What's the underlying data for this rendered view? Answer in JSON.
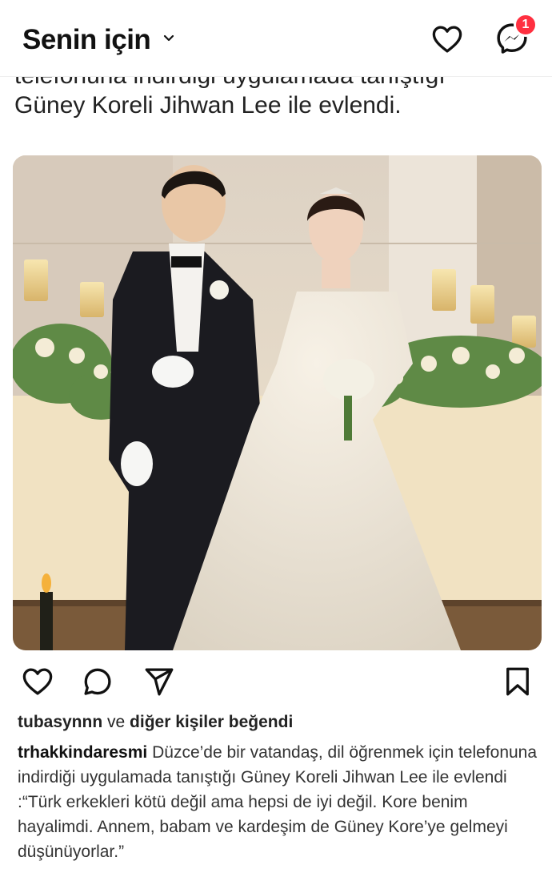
{
  "header": {
    "title": "Senin için",
    "notification_badge": "1"
  },
  "previous_post": {
    "clipped_line": "telefonuna indirdiği uygulamada tanıştığı",
    "last_line": "Güney Koreli Jihwan Lee ile evlendi."
  },
  "post": {
    "image_alt": "wedding-photo",
    "likes": {
      "user": "tubasynnn",
      "connector": "ve",
      "rest": "diğer kişiler beğendi"
    },
    "caption": {
      "user": "trhakkindaresmi",
      "text": "Düzce’de bir vatandaş, dil öğrenmek için telefonuna indirdiği uygulamada tanıştığı Güney Koreli Jihwan Lee ile evlendi :“Türk erkekleri kötü değil ama hepsi de iyi değil. Kore benim hayalimdi. Annem, babam ve kardeşim de Güney Kore’ye gelmeyi düşünüyorlar.”"
    }
  },
  "icons": {
    "header_left": "chevron-down-icon",
    "header_activity": "heart-icon",
    "header_messages": "messenger-icon",
    "actions": [
      "heart-icon",
      "comment-icon",
      "send-icon",
      "bookmark-icon"
    ]
  },
  "colors": {
    "badge": "#ff3040",
    "text": "#111111"
  }
}
